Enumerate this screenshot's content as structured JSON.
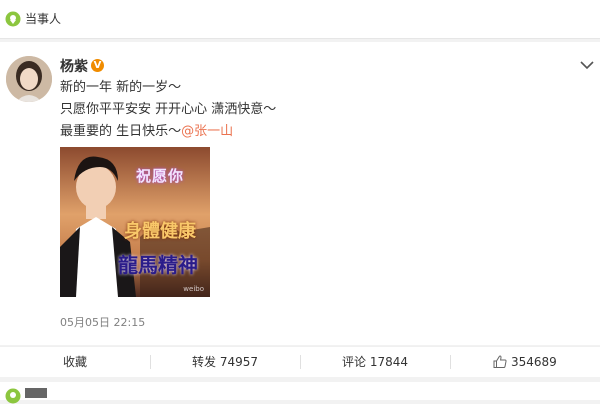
{
  "section": {
    "label": "当事人"
  },
  "post": {
    "username": "杨紫",
    "verified_badge": "V",
    "text_lines": [
      "新的一年 新的一岁～",
      "只愿你平平安安 开开心心 潇洒快意～"
    ],
    "line3_prefix": "最重要的 生日快乐～",
    "mention": "@张一山",
    "image": {
      "caption_top": "祝愿你",
      "caption_mid": "身體健康",
      "caption_bottom": "龍馬精神",
      "watermark": "weibo"
    },
    "timestamp": "05月05日 22:15"
  },
  "actions": {
    "favorite": "收藏",
    "repost_label": "转发",
    "repost_count": "74957",
    "comment_label": "评论",
    "comment_count": "17844",
    "like_count": "354689"
  },
  "colors": {
    "accent": "#eb7350",
    "badge": "#f08c00",
    "bg": "#f2f2f2",
    "icon_green": "#8cc63f"
  }
}
